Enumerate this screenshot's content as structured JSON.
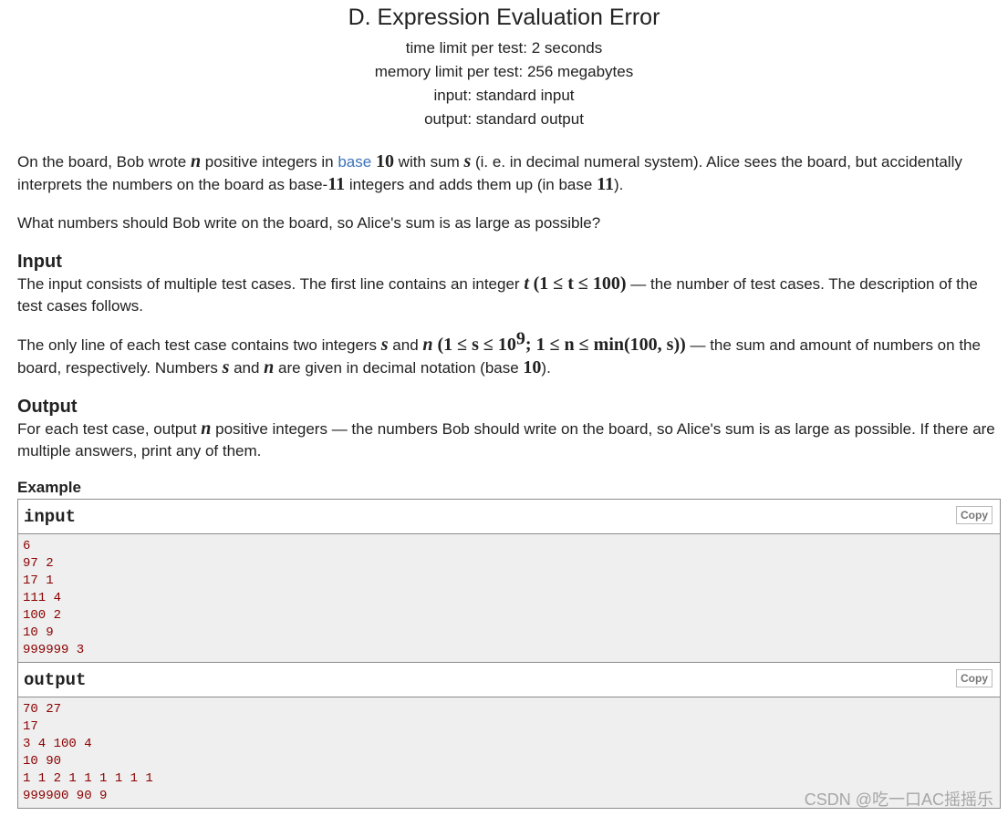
{
  "title": "D. Expression Evaluation Error",
  "limits": {
    "time": "time limit per test: 2 seconds",
    "memory": "memory limit per test: 256 megabytes",
    "input": "input: standard input",
    "output": "output: standard output"
  },
  "legend": {
    "p1": {
      "t1": "On the board, Bob wrote ",
      "v_n": "n",
      "t2": " positive integers in ",
      "link": "base",
      "t3": " ",
      "v_10": "10",
      "t4": " with sum ",
      "v_s": "s",
      "t5": " (i. e. in decimal numeral system). Alice sees the board, but accidentally interprets the numbers on the board as base-",
      "v_11": "11",
      "t6": " integers and adds them up (in base ",
      "v_11b": "11",
      "t7": ")."
    },
    "p2": "What numbers should Bob write on the board, so Alice's sum is as large as possible?"
  },
  "input_section": {
    "title": "Input",
    "p1": {
      "t1": "The input consists of multiple test cases. The first line contains an integer ",
      "v_t": "t",
      "constraint": "(1 ≤ t ≤ 100)",
      "t2": " — the number of test cases. The description of the test cases follows."
    },
    "p2": {
      "t1": "The only line of each test case contains two integers ",
      "v_s": "s",
      "t2": " and ",
      "v_n": "n",
      "c1": " (1 ≤ s ≤ 10",
      "c_exp": "9",
      "c2": "; 1 ≤ n ≤ min(100, s))",
      "t3": " — the sum and amount of numbers on the board, respectively. Numbers ",
      "v_s2": "s",
      "t4": " and ",
      "v_n2": "n",
      "t5": " are given in decimal notation (base ",
      "v_10": "10",
      "t6": ")."
    }
  },
  "output_section": {
    "title": "Output",
    "p1": "For each test case, output n positive integers — the numbers Bob should write on the board, so Alice's sum is as large as possible. If there are multiple answers, print any of them.",
    "p1a": "For each test case, output ",
    "p1v": "n",
    "p1b": " positive integers — the numbers Bob should write on the board, so Alice's sum is as large as possible. If there are multiple answers, print any of them."
  },
  "example": {
    "title": "Example",
    "copy_label": "Copy",
    "input_label": "input",
    "input_text": "6\n97 2\n17 1\n111 4\n100 2\n10 9\n999999 3",
    "output_label": "output",
    "output_text": "70 27\n17\n3 4 100 4\n10 90\n1 1 2 1 1 1 1 1 1\n999900 90 9"
  },
  "watermark": "CSDN @吃一口AC摇摇乐"
}
